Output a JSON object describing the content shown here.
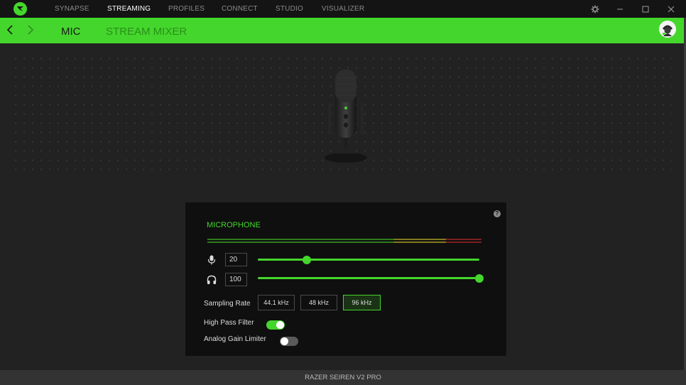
{
  "titlebar": {
    "nav": [
      {
        "label": "SYNAPSE",
        "active": false
      },
      {
        "label": "STREAMING",
        "active": true
      },
      {
        "label": "PROFILES",
        "active": false
      },
      {
        "label": "CONNECT",
        "active": false
      },
      {
        "label": "STUDIO",
        "active": false
      },
      {
        "label": "VISUALIZER",
        "active": false
      }
    ],
    "controls": [
      "gear-icon",
      "minimize-icon",
      "maximize-icon",
      "close-icon"
    ]
  },
  "subnav": {
    "tabs": [
      {
        "label": "MIC",
        "active": true
      },
      {
        "label": "STREAM MIXER",
        "active": false
      }
    ]
  },
  "panel": {
    "title": "MICROPHONE",
    "level_meter": {
      "green": "#44d62c",
      "yellow": "#c9c22a",
      "red": "#d62c2c"
    },
    "mic_gain": {
      "value": "20",
      "fraction": 0.22
    },
    "headphone_volume": {
      "value": "100",
      "fraction": 1.0
    },
    "sampling": {
      "label": "Sampling Rate",
      "options": [
        "44.1 kHz",
        "48 kHz",
        "96 kHz"
      ],
      "selected": "96 kHz"
    },
    "high_pass": {
      "label": "High Pass Filter",
      "on": true
    },
    "gain_limiter": {
      "label": "Analog Gain Limiter",
      "on": false
    }
  },
  "status": {
    "device": "RAZER SEIREN V2 PRO"
  },
  "colors": {
    "accent": "#44d62c",
    "bg": "#222222",
    "panel": "#0f0f0f"
  }
}
